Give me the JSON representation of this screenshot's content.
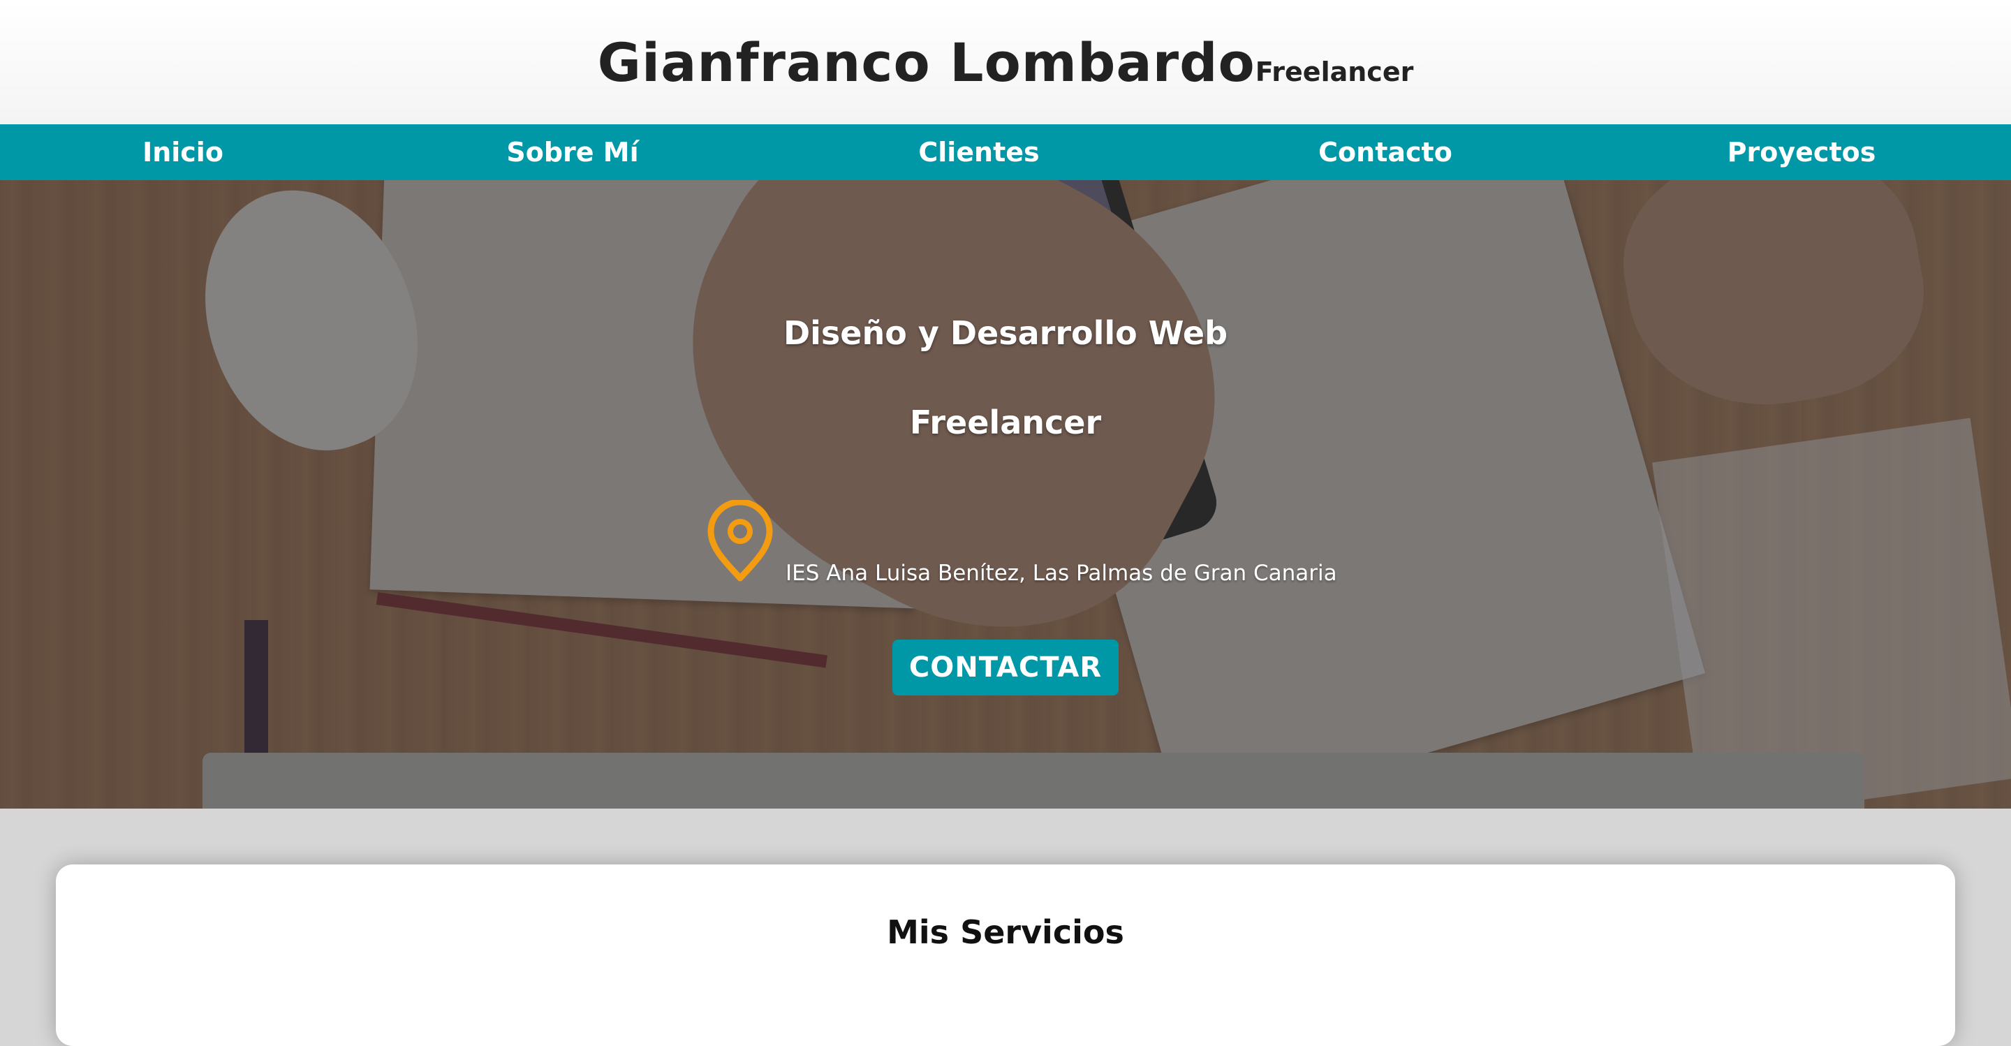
{
  "header": {
    "name": "Gianfranco Lombardo",
    "tagline": "Freelancer"
  },
  "nav": {
    "items": [
      {
        "label": "Inicio"
      },
      {
        "label": "Sobre Mí"
      },
      {
        "label": "Clientes"
      },
      {
        "label": "Contacto"
      },
      {
        "label": "Proyectos"
      }
    ]
  },
  "hero": {
    "title_line1": "Diseño y Desarrollo Web",
    "title_line2": "Freelancer",
    "location_icon": "map-pin-icon",
    "location": "IES Ana Luisa Benítez, Las Palmas de Gran Canaria",
    "cta_label": "CONTACTAR"
  },
  "services": {
    "title": "Mis Servicios"
  },
  "colors": {
    "accent": "#0097a7",
    "icon": "#f39c12",
    "text_dark": "#222222"
  }
}
